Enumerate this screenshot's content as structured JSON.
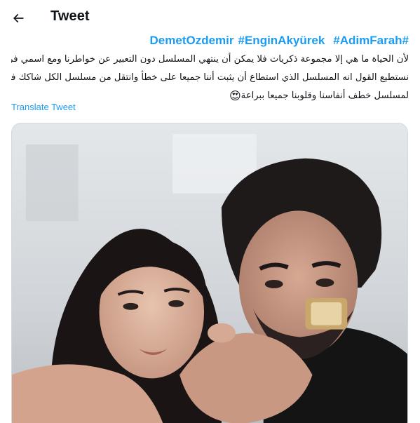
{
  "header": {
    "title": "Tweet",
    "back_icon": "arrow-left-icon"
  },
  "tweet": {
    "hashtags": [
      "#DemetOzdemir",
      "#EnginAkyürek",
      "#AdimFarah"
    ],
    "lines": [
      "لأن الحياة ما هي إلا مجموعة ذكريات فلا يمكن أن ينتهي المسلسل دون التعبير عن خواطرنا ومع اسمي فرح",
      "نستطيع القول انه المسلسل الذي استطاع أن يثبت أننا جميعا على خطأ وانتقل من مسلسل الكل شاكك فيه",
      "لمسلسل  خطف أنفاسنا وقلوبنا جميعا ببراعة"
    ],
    "emoji": "😍",
    "emoji_name": "heart-eyes-emoji",
    "translate_label": "Translate Tweet"
  },
  "media": {
    "kind": "photo",
    "colors": {
      "accent": "#1d9bf0",
      "border": "#cfd9de"
    }
  }
}
